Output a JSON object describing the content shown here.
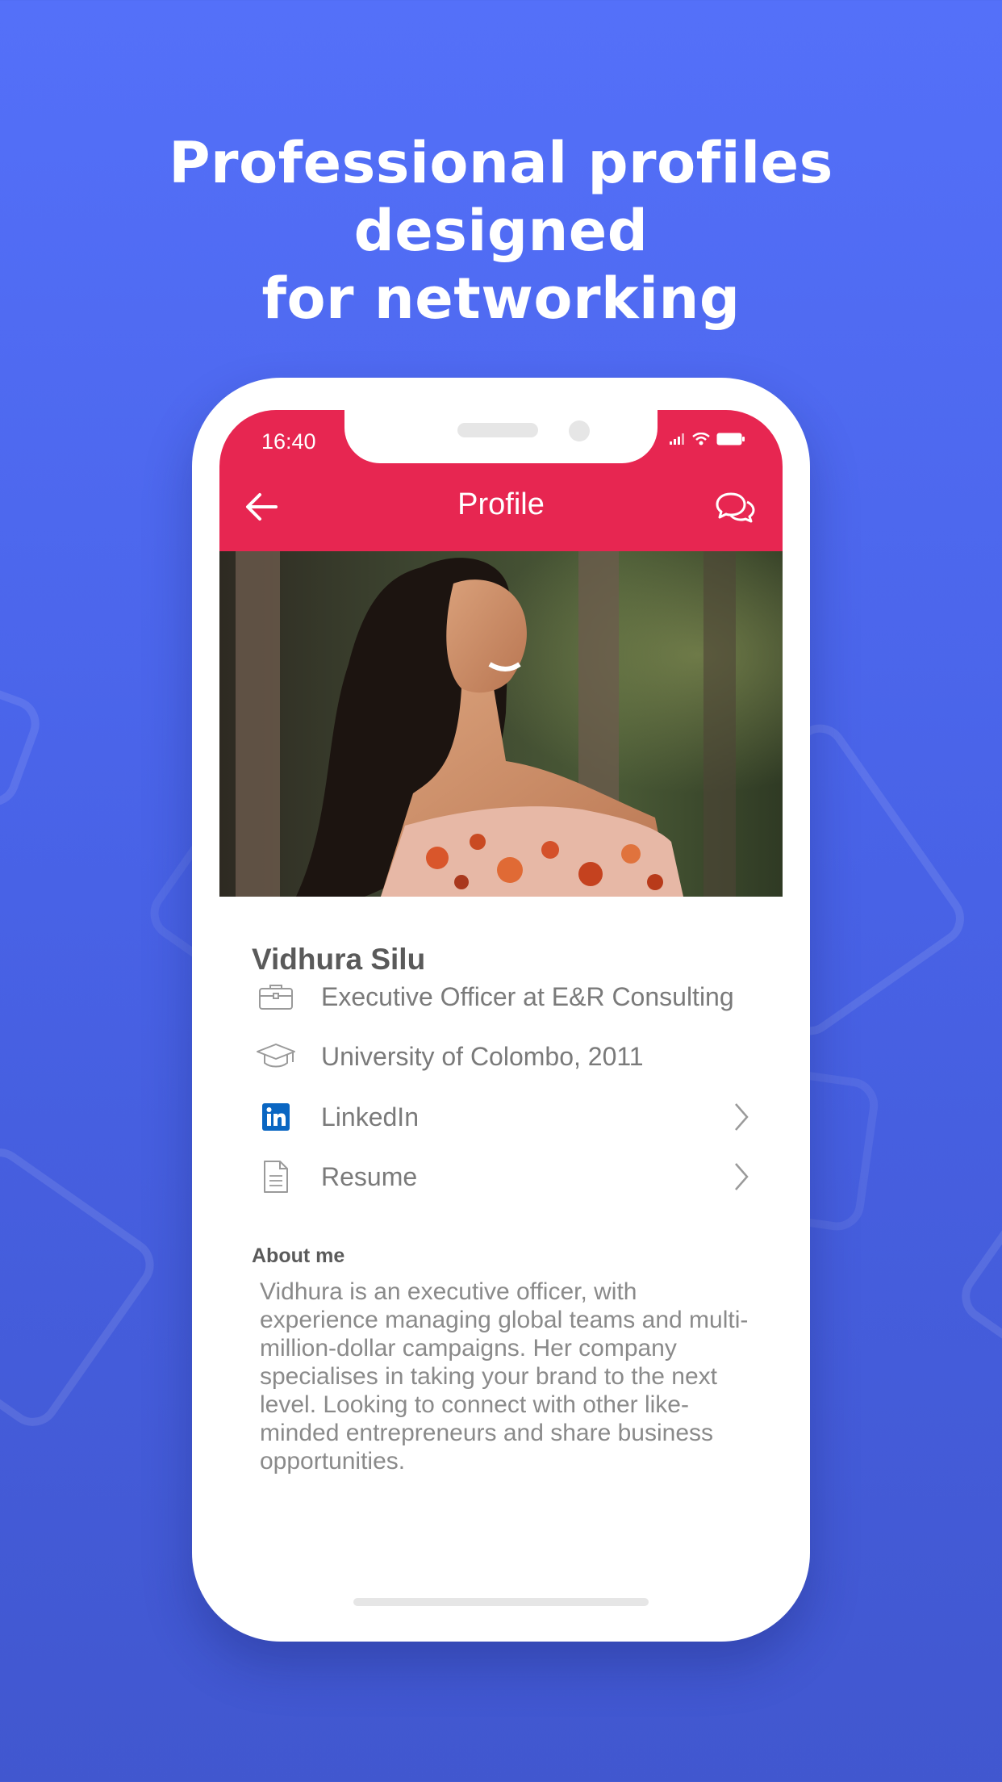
{
  "headline": {
    "line1": "Professional profiles designed",
    "line2": "for networking"
  },
  "status_bar": {
    "time": "16:40"
  },
  "app_bar": {
    "title": "Profile",
    "back_icon": "arrow-left-icon",
    "chat_icon": "chat-bubbles-icon"
  },
  "profile": {
    "name": "Vidhura Silu",
    "details": [
      {
        "icon": "briefcase-icon",
        "text": "Executive Officer at E&R Consulting"
      },
      {
        "icon": "graduation-cap-icon",
        "text": "University of Colombo, 2011"
      },
      {
        "icon": "linkedin-icon",
        "text": "LinkedIn"
      },
      {
        "icon": "document-icon",
        "text": "Resume"
      }
    ],
    "about_heading": "About me",
    "about_text": "Vidhura is an executive officer, with experience managing global teams and multi-million-dollar campaigns. Her company specialises in taking your brand to the next level. Looking to connect with other like-minded entrepreneurs and share business opportunities."
  },
  "colors": {
    "background": "#5470f9",
    "app_bar": "#e72651",
    "linkedin": "#0a66c2"
  }
}
